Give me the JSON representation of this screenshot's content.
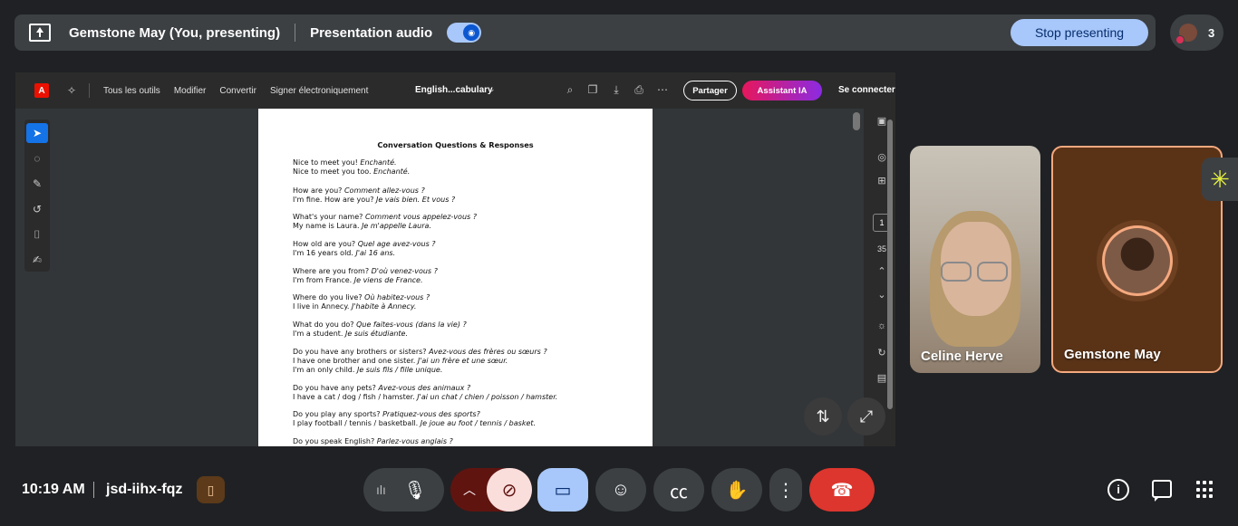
{
  "top_bar": {
    "presenter": "Gemstone May (You, presenting)",
    "audio_label": "Presentation audio",
    "audio_on": true,
    "stop_label": "Stop presenting",
    "people_count": "3"
  },
  "pdf_app": {
    "menus": [
      "Tous les outils",
      "Modifier",
      "Convertir",
      "Signer électroniquement"
    ],
    "document_name": "English...cabulary",
    "share_label": "Partager",
    "ai_label": "Assistant IA",
    "signin_label": "Se connecter",
    "current_page": "1",
    "total_pages": "35",
    "brand_color": "#eb1000"
  },
  "document": {
    "title": "Conversation Questions & Responses",
    "entries": [
      {
        "q": "Nice to meet you!",
        "qf": "Enchanté.",
        "a": "Nice to meet you too.",
        "af": "Enchanté."
      },
      {
        "q": "How are you?",
        "qf": "Comment allez-vous ?",
        "a": "I'm fine. How are you?",
        "af": "Je vais bien. Et vous ?"
      },
      {
        "q": "What's your name?",
        "qf": "Comment vous appelez-vous ?",
        "a": "My name is Laura.",
        "af": "Je m'appelle Laura."
      },
      {
        "q": "How old are you?",
        "qf": "Quel age avez-vous ?",
        "a": "I'm 16 years old.",
        "af": "J'ai 16 ans."
      },
      {
        "q": "Where are you from?",
        "qf": "D'où venez-vous ?",
        "a": "I'm from France.",
        "af": "Je viens de France."
      },
      {
        "q": "Where do you live?",
        "qf": "Où habitez-vous ?",
        "a": "I live in Annecy.",
        "af": "J'habite à Annecy."
      },
      {
        "q": "What do you do?",
        "qf": "Que faites-vous (dans la vie) ?",
        "a": "I'm a student.",
        "af": "Je suis étudiante."
      },
      {
        "q": "Do you have any brothers or sisters?",
        "qf": "Avez-vous des frères ou sœurs ?",
        "a": "I have one brother and one sister.",
        "af": "J'ai un frère et une sœur.",
        "a2": "I'm an only child.",
        "af2": "Je suis fils / fille unique."
      },
      {
        "q": "Do you have any pets?",
        "qf": "Avez-vous des animaux ?",
        "a": "I have a cat / dog / fish / hamster.",
        "af": "J'ai un chat / chien / poisson / hamster."
      },
      {
        "q": "Do you play any sports?",
        "qf": "Pratiquez-vous des sports?",
        "a": "I play football / tennis / basketball.",
        "af": "Je joue au foot / tennis / basket."
      },
      {
        "q": "Do you speak English?",
        "qf": "Parlez-vous anglais ?"
      }
    ]
  },
  "participants": [
    {
      "name": "Celine Herve"
    },
    {
      "name": "Gemstone May",
      "accent": "#f5a97f"
    }
  ],
  "bottom_bar": {
    "time": "10:19 AM",
    "meeting_code": "jsd-iihx-fqz",
    "leave_color": "#dc362e",
    "present_color": "#a8c7fa"
  }
}
